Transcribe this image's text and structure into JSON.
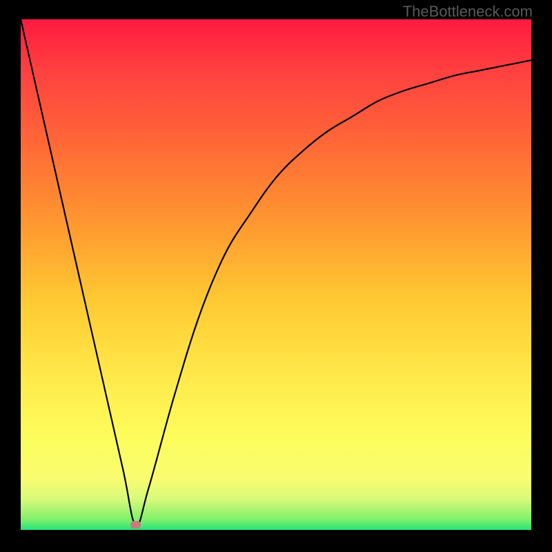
{
  "watermark": "TheBottleneck.com",
  "chart_data": {
    "type": "line",
    "title": "",
    "xlabel": "",
    "ylabel": "",
    "xlim": [
      0,
      100
    ],
    "ylim": [
      0,
      100
    ],
    "legend": false,
    "grid": false,
    "background_gradient": [
      "#ff1a40",
      "#ff6a36",
      "#ffc933",
      "#fdfd5c",
      "#24e37a"
    ],
    "series": [
      {
        "name": "bottleneck-curve",
        "x": [
          0,
          5,
          10,
          15,
          20,
          22.5,
          25,
          30,
          35,
          40,
          45,
          50,
          55,
          60,
          65,
          70,
          75,
          80,
          85,
          90,
          95,
          100
        ],
        "values": [
          100,
          78,
          56,
          34,
          12,
          1,
          8,
          26,
          42,
          54,
          62,
          69,
          74,
          78,
          81,
          84,
          86,
          87.5,
          89,
          90,
          91,
          92
        ]
      }
    ],
    "marker": {
      "x": 22.5,
      "y": 1,
      "color": "#c97a7a"
    },
    "annotations": []
  }
}
